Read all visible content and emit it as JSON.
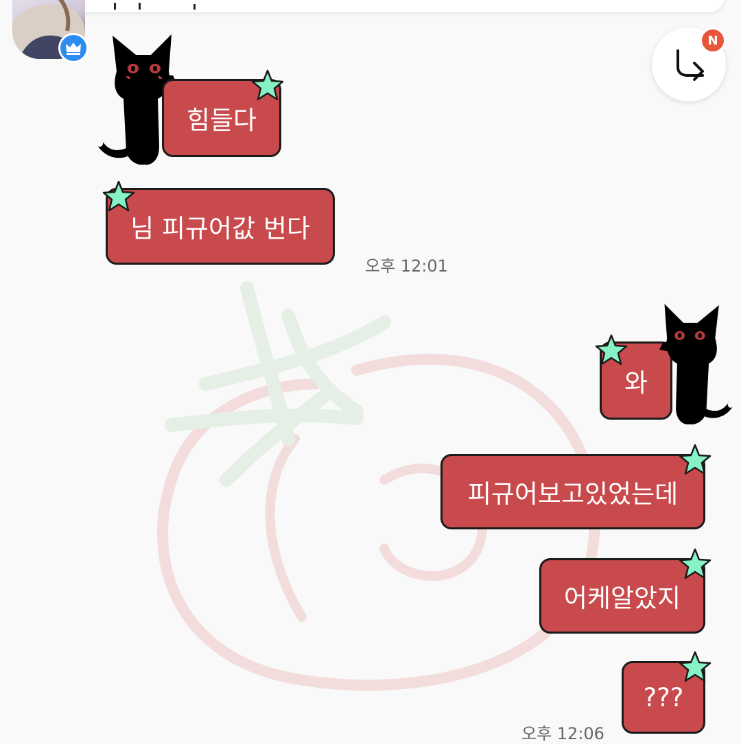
{
  "colors": {
    "bubble": "#c84a4d",
    "bubble_border": "#1b1b1b",
    "bubble_text": "#ffffff",
    "star": "#86f2c5",
    "cat": "#000000",
    "badge_crown": "#2d8cf0",
    "badge_new": "#e8553b",
    "background": "#f9f9f9"
  },
  "icons": {
    "crown": "crown-icon",
    "reply": "reply-arrow-icon",
    "star": "star-sticker-icon",
    "cat": "black-cat-sticker"
  },
  "reply_button": {
    "badge": "N"
  },
  "messages_received": [
    {
      "text": "힘들다"
    },
    {
      "text": "님 피규어값 번다"
    }
  ],
  "time_received": "오후 12:01",
  "messages_sent": [
    {
      "text": "와"
    },
    {
      "text": "피규어보고있었는데"
    },
    {
      "text": "어케알았지"
    },
    {
      "text": "???"
    }
  ],
  "time_sent": "오후 12:06"
}
